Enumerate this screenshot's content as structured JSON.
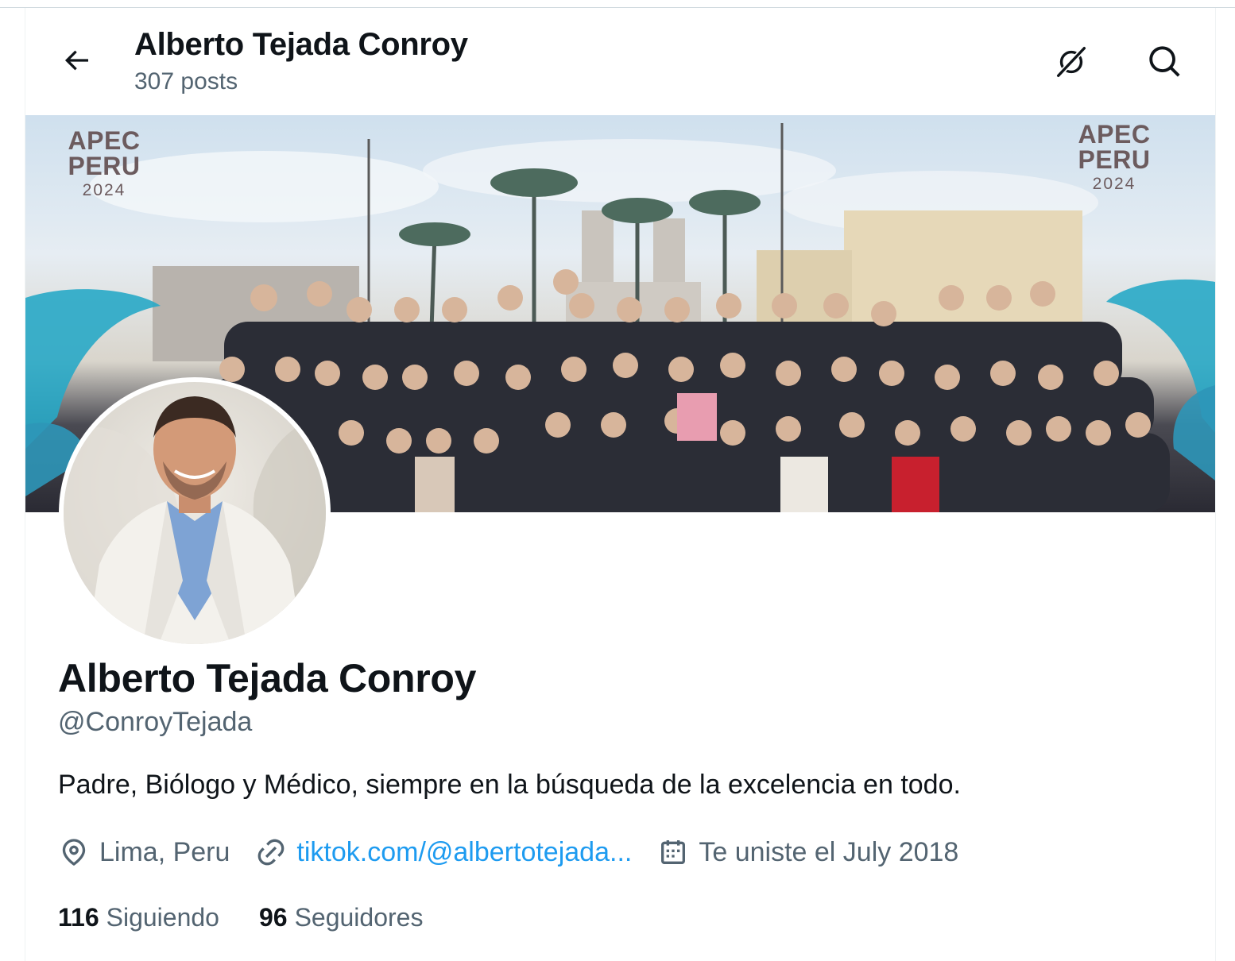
{
  "header": {
    "title": "Alberto Tejada Conroy",
    "subtitle": "307 posts",
    "back_icon": "arrow-left-icon",
    "grok_icon": "grok-icon",
    "search_icon": "search-icon"
  },
  "banner": {
    "logo_left_line1": "APEC PERU",
    "logo_left_line2": "2024",
    "logo_right_line1": "APEC PERU",
    "logo_right_line2": "2024"
  },
  "profile": {
    "name": "Alberto Tejada Conroy",
    "handle": "@ConroyTejada",
    "bio": "Padre, Biólogo y Médico, siempre en la búsqueda de la excelencia en todo.",
    "location": "Lima, Peru",
    "website": "tiktok.com/@albertotejada...",
    "joined": "Te uniste el July 2018",
    "following_count": "116",
    "following_label": "Siguiendo",
    "followers_count": "96",
    "followers_label": "Seguidores"
  },
  "colors": {
    "text": "#0f1419",
    "secondary": "#536471",
    "link": "#1d9bf0",
    "border": "#eff3f4"
  }
}
